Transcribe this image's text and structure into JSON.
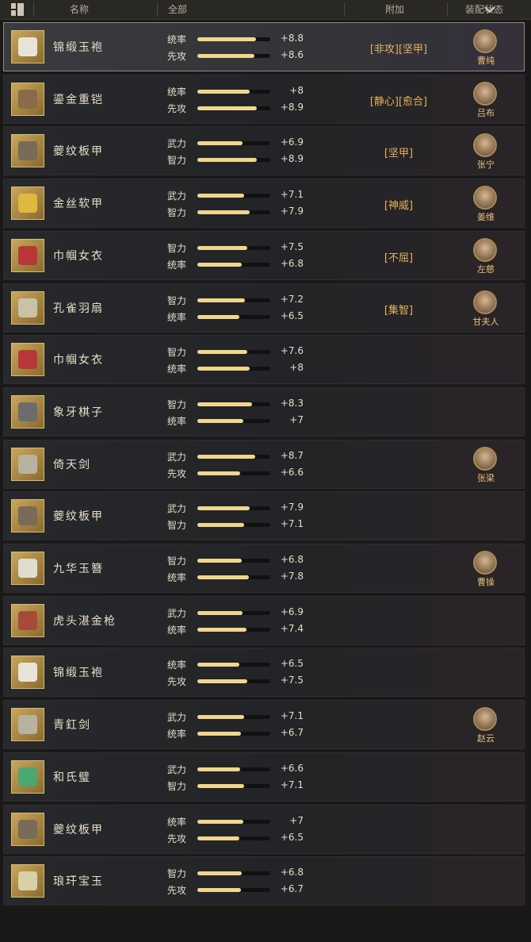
{
  "header": {
    "name_label": "名称",
    "filter_label": "全部",
    "extra_label": "附加",
    "status_label": "装配状态"
  },
  "colors": {
    "bar_fill": "#f0d78a",
    "extra_text": "#e2b35c",
    "hero_text": "#e8c37a"
  },
  "items": [
    {
      "name": "锦缎玉袍",
      "icon": "robe-icon",
      "stat1": "统率",
      "val1": "+8.8",
      "fill1": 0.8,
      "stat2": "先攻",
      "val2": "+8.6",
      "fill2": 0.78,
      "extra": "[非攻][坚甲]",
      "hero": "曹纯"
    },
    {
      "name": "鎏金重铠",
      "icon": "armor-icon",
      "stat1": "统率",
      "val1": "+8",
      "fill1": 0.72,
      "stat2": "先攻",
      "val2": "+8.9",
      "fill2": 0.81,
      "extra": "[静心][愈合]",
      "hero": "吕布"
    },
    {
      "name": "夔纹板甲",
      "icon": "plate-armor-icon",
      "stat1": "武力",
      "val1": "+6.9",
      "fill1": 0.62,
      "stat2": "智力",
      "val2": "+8.9",
      "fill2": 0.81,
      "extra": "[坚甲]",
      "hero": "张宁"
    },
    {
      "name": "金丝软甲",
      "icon": "gold-armor-icon",
      "stat1": "武力",
      "val1": "+7.1",
      "fill1": 0.64,
      "stat2": "智力",
      "val2": "+7.9",
      "fill2": 0.72,
      "extra": "[神威]",
      "hero": "姜维"
    },
    {
      "name": "巾帼女衣",
      "icon": "dress-icon",
      "stat1": "智力",
      "val1": "+7.5",
      "fill1": 0.68,
      "stat2": "统率",
      "val2": "+6.8",
      "fill2": 0.61,
      "extra": "[不屈]",
      "hero": "左慈"
    },
    {
      "name": "孔雀羽扇",
      "icon": "fan-icon",
      "stat1": "智力",
      "val1": "+7.2",
      "fill1": 0.65,
      "stat2": "统率",
      "val2": "+6.5",
      "fill2": 0.58,
      "extra": "[集智]",
      "hero": "甘夫人"
    },
    {
      "name": "巾帼女衣",
      "icon": "dress-icon",
      "stat1": "智力",
      "val1": "+7.6",
      "fill1": 0.69,
      "stat2": "统率",
      "val2": "+8",
      "fill2": 0.72,
      "extra": "",
      "hero": ""
    },
    {
      "name": "象牙棋子",
      "icon": "chess-icon",
      "stat1": "智力",
      "val1": "+8.3",
      "fill1": 0.75,
      "stat2": "统率",
      "val2": "+7",
      "fill2": 0.63,
      "extra": "",
      "hero": ""
    },
    {
      "name": "倚天剑",
      "icon": "sword-icon",
      "stat1": "武力",
      "val1": "+8.7",
      "fill1": 0.79,
      "stat2": "先攻",
      "val2": "+6.6",
      "fill2": 0.59,
      "extra": "",
      "hero": "张梁"
    },
    {
      "name": "夔纹板甲",
      "icon": "plate-armor-icon",
      "stat1": "武力",
      "val1": "+7.9",
      "fill1": 0.72,
      "stat2": "智力",
      "val2": "+7.1",
      "fill2": 0.64,
      "extra": "",
      "hero": ""
    },
    {
      "name": "九华玉簪",
      "icon": "hairpin-icon",
      "stat1": "智力",
      "val1": "+6.8",
      "fill1": 0.61,
      "stat2": "统率",
      "val2": "+7.8",
      "fill2": 0.71,
      "extra": "",
      "hero": "曹操"
    },
    {
      "name": "虎头湛金枪",
      "icon": "spear-icon",
      "stat1": "武力",
      "val1": "+6.9",
      "fill1": 0.62,
      "stat2": "统率",
      "val2": "+7.4",
      "fill2": 0.67,
      "extra": "",
      "hero": ""
    },
    {
      "name": "锦缎玉袍",
      "icon": "robe-icon",
      "stat1": "统率",
      "val1": "+6.5",
      "fill1": 0.58,
      "stat2": "先攻",
      "val2": "+7.5",
      "fill2": 0.68,
      "extra": "",
      "hero": ""
    },
    {
      "name": "青釭剑",
      "icon": "sword-icon",
      "stat1": "武力",
      "val1": "+7.1",
      "fill1": 0.64,
      "stat2": "统率",
      "val2": "+6.7",
      "fill2": 0.6,
      "extra": "",
      "hero": "赵云"
    },
    {
      "name": "和氏璧",
      "icon": "jade-disc-icon",
      "stat1": "武力",
      "val1": "+6.6",
      "fill1": 0.59,
      "stat2": "智力",
      "val2": "+7.1",
      "fill2": 0.64,
      "extra": "",
      "hero": ""
    },
    {
      "name": "夔纹板甲",
      "icon": "plate-armor-icon",
      "stat1": "统率",
      "val1": "+7",
      "fill1": 0.63,
      "stat2": "先攻",
      "val2": "+6.5",
      "fill2": 0.58,
      "extra": "",
      "hero": ""
    },
    {
      "name": "琅玕宝玉",
      "icon": "jade-seal-icon",
      "stat1": "智力",
      "val1": "+6.8",
      "fill1": 0.61,
      "stat2": "先攻",
      "val2": "+6.7",
      "fill2": 0.6,
      "extra": "",
      "hero": ""
    }
  ]
}
